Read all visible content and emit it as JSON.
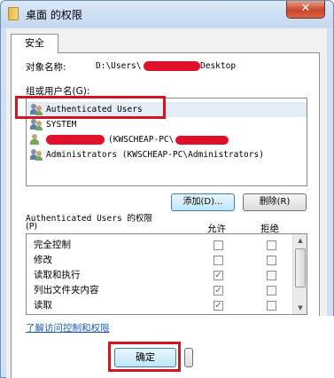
{
  "window": {
    "title": "桌面 的权限",
    "close_label": "✕"
  },
  "tabs": [
    {
      "label": "安全"
    }
  ],
  "object": {
    "label": "对象名称:",
    "path_prefix": "D:\\Users\\",
    "path_suffix": "Desktop"
  },
  "group": {
    "label": "组或用户名(G):",
    "items": [
      {
        "text": "Authenticated Users",
        "icon": "users-icon"
      },
      {
        "text": "SYSTEM",
        "icon": "users-icon"
      },
      {
        "text": "(KWSCHEAP-PC\\",
        "icon": "user-icon"
      },
      {
        "text": "Administrators (KWSCHEAP-PC\\Administrators)",
        "icon": "users-icon"
      }
    ]
  },
  "buttons": {
    "add": "添加(D)...",
    "remove": "删除(R)",
    "ok": "确定"
  },
  "permissions": {
    "header_line1": "Authenticated Users 的权限",
    "header_line2": "(P)",
    "allow_col": "允许",
    "deny_col": "拒绝",
    "rows": [
      {
        "name": "完全控制",
        "allow": false,
        "deny": false
      },
      {
        "name": "修改",
        "allow": false,
        "deny": false
      },
      {
        "name": "读取和执行",
        "allow": true,
        "deny": false
      },
      {
        "name": "列出文件夹内容",
        "allow": true,
        "deny": false
      },
      {
        "name": "读取",
        "allow": true,
        "deny": false
      }
    ]
  },
  "link": "了解访问控制和权限",
  "colors": {
    "highlight": "#d4141e",
    "redaction": "#e0102a",
    "link": "#1a5fb4"
  }
}
